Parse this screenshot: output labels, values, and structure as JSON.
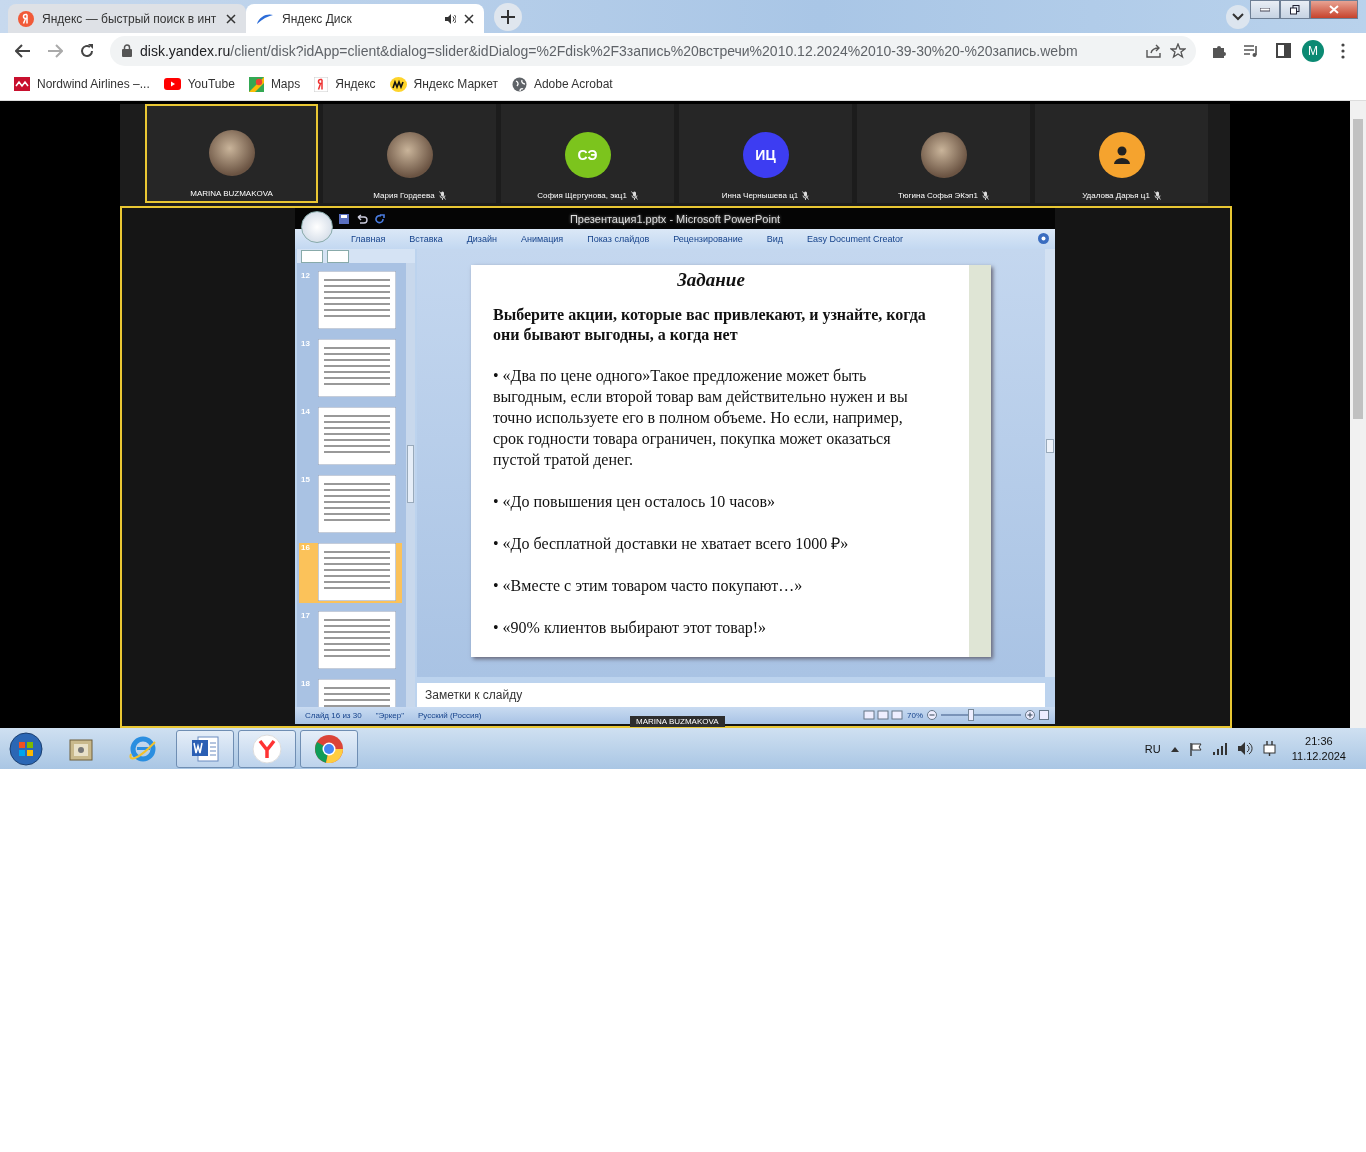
{
  "browser": {
    "tabs": [
      {
        "title": "Яндекс — быстрый поиск в инт",
        "kind": "yandex",
        "selected": false,
        "audio": false
      },
      {
        "title": "Яндекс Диск",
        "kind": "disk",
        "selected": true,
        "audio": true
      }
    ],
    "url_host": "disk.yandex.ru",
    "url_path": "/client/disk?idApp=client&dialog=slider&idDialog=%2Fdisk%2F3запись%20встречи%2010.12.2024%2010-39-30%20-%20запись.webm",
    "profile_initial": "M",
    "bookmarks": [
      {
        "label": "Nordwind Airlines –...",
        "kind": "nordwind"
      },
      {
        "label": "YouTube",
        "kind": "youtube"
      },
      {
        "label": "Maps",
        "kind": "maps"
      },
      {
        "label": "Яндекс",
        "kind": "yandex"
      },
      {
        "label": "Яндекс Маркет",
        "kind": "market"
      },
      {
        "label": "Adobe Acrobat",
        "kind": "globe"
      }
    ]
  },
  "participants": [
    {
      "name": "MARINA BUZMAKOVA",
      "kind": "photo",
      "muted": false,
      "selected": true
    },
    {
      "name": "Мария Гордеева",
      "kind": "photo",
      "muted": true,
      "selected": false
    },
    {
      "name": "София Щергунова, экц1",
      "kind": "initials",
      "initials": "СЭ",
      "color": "#7cc41d",
      "muted": true,
      "selected": false
    },
    {
      "name": "Инна Чернышева ц1",
      "kind": "initials",
      "initials": "ИЦ",
      "color": "#3d3df2",
      "muted": true,
      "selected": false
    },
    {
      "name": "Тюгина Софья ЭКэп1",
      "kind": "photo",
      "muted": true,
      "selected": false
    },
    {
      "name": "Удалова Дарья ц1",
      "kind": "icon",
      "color": "#f5a32e",
      "muted": true,
      "selected": false
    }
  ],
  "powerpoint": {
    "title": "Презентация1.pptx - Microsoft PowerPoint",
    "ribbon_tabs": [
      "Главная",
      "Вставка",
      "Дизайн",
      "Анимация",
      "Показ слайдов",
      "Рецензирование",
      "Вид",
      "Easy Document Creator"
    ],
    "thumbnails": [
      {
        "number": "12",
        "selected": false
      },
      {
        "number": "13",
        "selected": false
      },
      {
        "number": "14",
        "selected": false
      },
      {
        "number": "15",
        "selected": false
      },
      {
        "number": "16",
        "selected": true
      },
      {
        "number": "17",
        "selected": false
      },
      {
        "number": "18",
        "selected": false
      }
    ],
    "slide": {
      "title": "Задание",
      "heading": "Выберите акции, которые вас привлекают, и узнайте, когда они бывают выгодны, а когда нет",
      "bullets": [
        "• «Два по цене одного»Такое предложение может быть выгодным, если второй товар вам действительно нужен и вы точно используете его в полном объеме. Но если, например, срок годности товара ограничен, покупка может оказаться пустой тратой денег.",
        "• «До повышения цен осталось 10 часов»",
        "• «До бесплатной доставки не хватает всего 1000 ₽»",
        "• «Вместе с этим товаром часто покупают…»",
        "• «90% клиентов выбирают этот товар!»"
      ]
    },
    "notes_placeholder": "Заметки к слайду",
    "status": [
      "Слайд 16 из 30",
      "\"Эркер\"",
      "Русский (Россия)"
    ],
    "zoom": "70%",
    "zoom_level": {
      "level": 0.36
    }
  },
  "presenter_label": "MARINA BUZMAKOVA",
  "taskbar": {
    "apps": [
      {
        "kind": "explorer",
        "open": false
      },
      {
        "kind": "ie",
        "open": false
      },
      {
        "kind": "word",
        "open": true
      },
      {
        "kind": "yandex",
        "open": true
      },
      {
        "kind": "chrome",
        "open": true
      }
    ],
    "language": "RU",
    "time": "21:36",
    "date": "11.12.2024"
  }
}
